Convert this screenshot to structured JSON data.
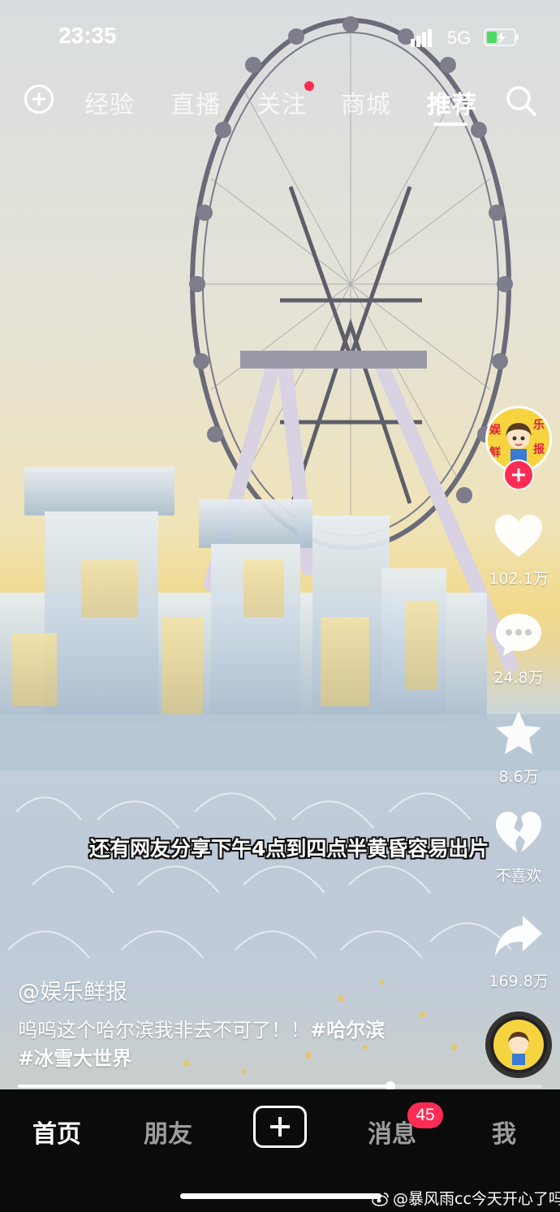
{
  "status_bar": {
    "time": "23:35",
    "network": "5G"
  },
  "top_nav": {
    "tabs": [
      {
        "label": "经验"
      },
      {
        "label": "直播"
      },
      {
        "label": "关注",
        "has_dot": true
      },
      {
        "label": "商城"
      },
      {
        "label": "推荐",
        "active": true
      }
    ]
  },
  "video": {
    "subtitle": "还有网友分享下午4点到四点半黄昏容易出片",
    "author": "@娱乐鲜报",
    "description": "呜呜这个哈尔滨我非去不可了！！",
    "hashtags": [
      "#哈尔滨",
      "#冰雪大世界"
    ],
    "progress": 0.71
  },
  "right_rail": {
    "avatar_text": [
      "娱",
      "乐",
      "鲜",
      "报"
    ],
    "likes": "102.1万",
    "comments": "24.8万",
    "favorites": "8.6万",
    "dislike_label": "不喜欢",
    "shares": "169.8万"
  },
  "bottom_nav": {
    "tabs": [
      {
        "label": "首页",
        "active": true
      },
      {
        "label": "朋友"
      },
      {
        "label": "消息"
      },
      {
        "label": "我"
      }
    ],
    "message_badge": "45"
  },
  "watermark": "@暴风雨cc今天开心了吗",
  "colors": {
    "accent": "#fe2c55",
    "bottom_bar": "#0b0b0b"
  }
}
